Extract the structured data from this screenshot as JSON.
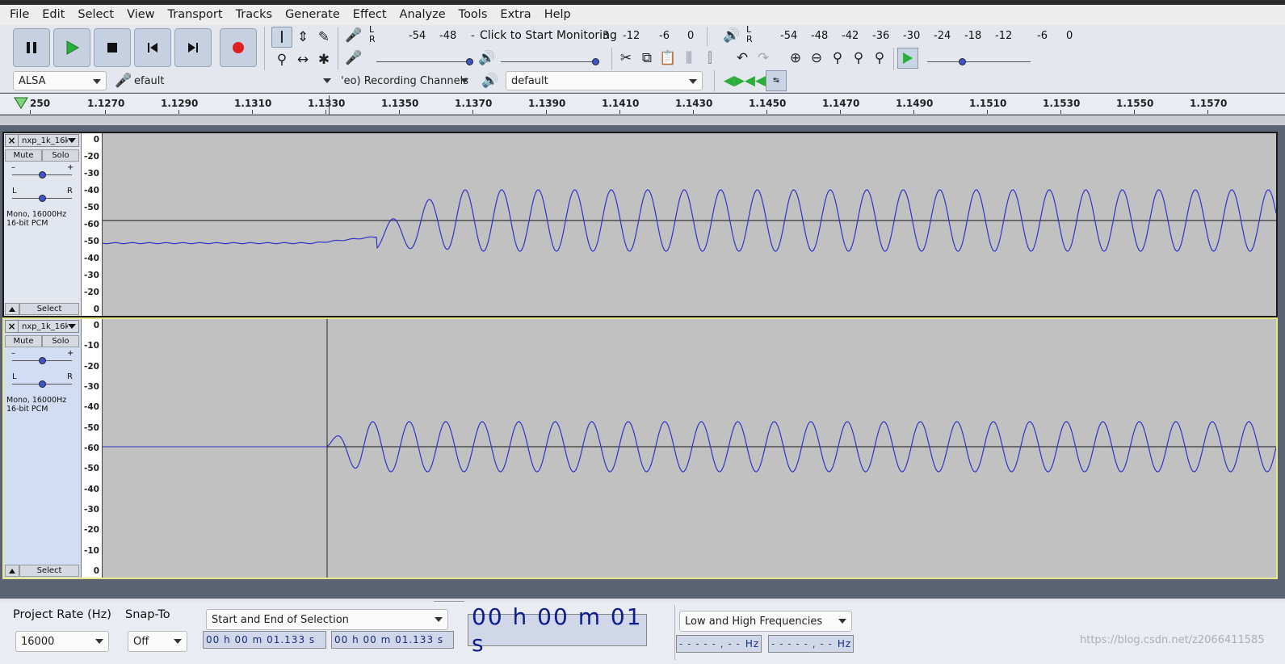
{
  "menubar": {
    "items": [
      "File",
      "Edit",
      "Select",
      "View",
      "Transport",
      "Tracks",
      "Generate",
      "Effect",
      "Analyze",
      "Tools",
      "Extra",
      "Help"
    ]
  },
  "recording_meter": {
    "lr": "L\nR",
    "scale": [
      "-54",
      "-48",
      "-",
      "3",
      "-12",
      "-6",
      "0"
    ],
    "prompt": "Click to Start Monitoring"
  },
  "playback_meter": {
    "lr": "L\nR",
    "scale": [
      "-54",
      "-48",
      "-42",
      "-36",
      "-30",
      "-24",
      "-18",
      "-12",
      "-6",
      "0"
    ]
  },
  "device_toolbar": {
    "host": "ALSA",
    "recording_device": "efault",
    "channels": "'eo) Recording Channels",
    "playback_device": "default"
  },
  "ruler": {
    "labels": [
      "250",
      "1.1270",
      "1.1290",
      "1.1310",
      "1.1330",
      "1.1350",
      "1.1370",
      "1.1390",
      "1.1410",
      "1.1430",
      "1.1450",
      "1.1470",
      "1.1490",
      "1.1510",
      "1.1530",
      "1.1550",
      "1.1570"
    ]
  },
  "tracks": [
    {
      "name": "nxp_1k_16k_",
      "mute": "Mute",
      "solo": "Solo",
      "info": "Mono, 16000Hz\n16-bit PCM",
      "select": "Select",
      "pan_l": "L",
      "pan_r": "R",
      "gain_minus": "–",
      "gain_plus": "+",
      "vruler": [
        "0",
        "-20",
        "-30",
        "-40",
        "-50",
        "-60",
        "-50",
        "-40",
        "-30",
        "-20",
        "0"
      ]
    },
    {
      "name": "nxp_1k_16k_",
      "mute": "Mute",
      "solo": "Solo",
      "info": "Mono, 16000Hz\n16-bit PCM",
      "select": "Select",
      "pan_l": "L",
      "pan_r": "R",
      "gain_minus": "–",
      "gain_plus": "+",
      "vruler": [
        "0",
        "-10",
        "-20",
        "-30",
        "-40",
        "-50",
        "-60",
        "-50",
        "-40",
        "-30",
        "-20",
        "-10",
        "0"
      ]
    }
  ],
  "statusbar": {
    "project_rate_label": "Project Rate (Hz)",
    "project_rate_value": "16000",
    "snap_to_label": "Snap-To",
    "snap_to_value": "Off",
    "selection_mode": "Start and End of Selection",
    "sel_start": "00 h 00 m 01.133 s",
    "sel_end": "00 h 00 m 01.133 s",
    "audio_position": "00 h 00 m 01 s",
    "spectral_mode": "Low and High Frequencies",
    "freq_low": "- - - - - , - -",
    "freq_high": "- - - - - , - -",
    "hz_unit": "Hz"
  },
  "watermark": "https://blog.csdn.net/z2066411585",
  "colors": {
    "waveform": "#3232c8",
    "record": "#e02020",
    "play": "#2cae3a"
  }
}
